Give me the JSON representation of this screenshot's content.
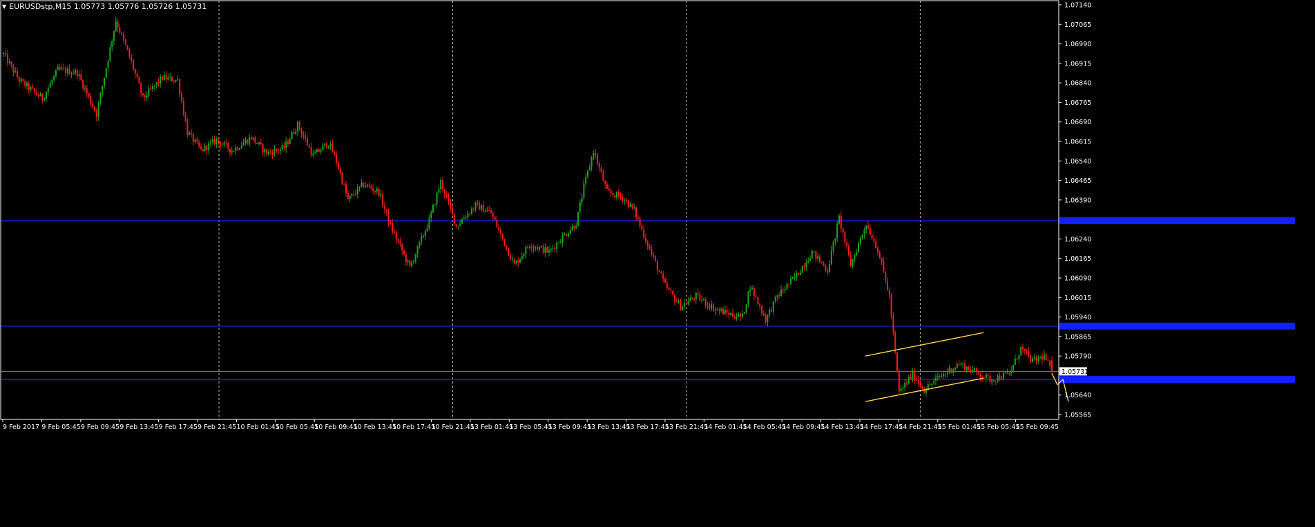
{
  "header": {
    "symbol_line": "EURUSDstp,M15  1.05773 1.05776 1.05726 1.05731"
  },
  "theme": {
    "background": "#000000",
    "frame": "#ffffff",
    "text": "#ffffff",
    "grid": "#c0c0c0",
    "bull": "#1aa81a",
    "bear": "#ff1a1a",
    "hline": "#1020ff",
    "channel": "#ffd24d",
    "price_line": "#808080"
  },
  "chart_data": {
    "type": "candlestick",
    "symbol": "EURUSDstp",
    "timeframe": "M15",
    "ohlc_last": {
      "open": 1.05773,
      "high": 1.05776,
      "low": 1.05726,
      "close": 1.05731
    },
    "ylim": [
      1.05565,
      1.0714
    ],
    "y_ticks": [
      "1.07140",
      "1.07065",
      "1.06990",
      "1.06915",
      "1.06840",
      "1.06765",
      "1.06690",
      "1.06615",
      "1.06540",
      "1.06465",
      "1.06390",
      "1.06240",
      "1.06165",
      "1.06090",
      "1.06015",
      "1.05940",
      "1.05865",
      "1.05790",
      "1.05640",
      "1.05565"
    ],
    "x_ticks": [
      "9 Feb 2017",
      "9 Feb 05:45",
      "9 Feb 09:45",
      "9 Feb 13:45",
      "9 Feb 17:45",
      "9 Feb 21:45",
      "10 Feb 01:45",
      "10 Feb 05:45",
      "10 Feb 09:45",
      "10 Feb 13:45",
      "10 Feb 17:45",
      "10 Feb 21:45",
      "13 Feb 01:45",
      "13 Feb 05:45",
      "13 Feb 09:45",
      "13 Feb 13:45",
      "13 Feb 17:45",
      "13 Feb 21:45",
      "14 Feb 01:45",
      "14 Feb 05:45",
      "14 Feb 09:45",
      "14 Feb 13:45",
      "14 Feb 17:45",
      "14 Feb 21:45",
      "15 Feb 01:45",
      "15 Feb 05:45",
      "15 Feb 09:45"
    ],
    "period_separators": [
      "9 Feb 21:45",
      "10 Feb 21:45",
      "13 Feb 21:45",
      "14 Feb 21:45"
    ],
    "horizontal_lines": [
      1.0631,
      1.05905,
      1.057
    ],
    "current_price": "1.05731",
    "trend_channel": {
      "upper": {
        "from": [
          "14 Feb 17:45",
          1.0579
        ],
        "to": [
          "15 Feb 05:45",
          1.0588
        ]
      },
      "lower": {
        "from": [
          "14 Feb 17:45",
          1.05615
        ],
        "to": [
          "15 Feb 05:45",
          1.05705
        ]
      }
    },
    "projection_path": [
      [
        0,
        1.05723
      ],
      [
        1,
        1.0568
      ],
      [
        2,
        1.057
      ],
      [
        3,
        1.05615
      ]
    ],
    "price_path": [
      [
        0,
        1.0695
      ],
      [
        8,
        1.0685
      ],
      [
        20,
        1.0678
      ],
      [
        28,
        1.0689
      ],
      [
        38,
        1.0688
      ],
      [
        48,
        1.0672
      ],
      [
        58,
        1.0708
      ],
      [
        66,
        1.0692
      ],
      [
        72,
        1.0678
      ],
      [
        82,
        1.0686
      ],
      [
        90,
        1.0685
      ],
      [
        95,
        1.0665
      ],
      [
        102,
        1.0658
      ],
      [
        110,
        1.0662
      ],
      [
        118,
        1.0658
      ],
      [
        128,
        1.0663
      ],
      [
        136,
        1.0657
      ],
      [
        145,
        1.0659
      ],
      [
        152,
        1.0668
      ],
      [
        160,
        1.0656
      ],
      [
        168,
        1.0661
      ],
      [
        172,
        1.0654
      ],
      [
        178,
        1.0639
      ],
      [
        186,
        1.0645
      ],
      [
        194,
        1.0642
      ],
      [
        200,
        1.0629
      ],
      [
        210,
        1.0613
      ],
      [
        220,
        1.0631
      ],
      [
        226,
        1.0646
      ],
      [
        234,
        1.0629
      ],
      [
        244,
        1.0637
      ],
      [
        252,
        1.0634
      ],
      [
        258,
        1.0624
      ],
      [
        264,
        1.0614
      ],
      [
        272,
        1.0622
      ],
      [
        282,
        1.0619
      ],
      [
        288,
        1.0624
      ],
      [
        296,
        1.063
      ],
      [
        300,
        1.0644
      ],
      [
        305,
        1.0658
      ],
      [
        312,
        1.0642
      ],
      [
        320,
        1.064
      ],
      [
        326,
        1.0635
      ],
      [
        334,
        1.062
      ],
      [
        342,
        1.0606
      ],
      [
        350,
        1.0598
      ],
      [
        358,
        1.0602
      ],
      [
        368,
        1.0597
      ],
      [
        376,
        1.0595
      ],
      [
        382,
        1.0594
      ],
      [
        386,
        1.0606
      ],
      [
        394,
        1.0593
      ],
      [
        400,
        1.0602
      ],
      [
        410,
        1.061
      ],
      [
        418,
        1.0619
      ],
      [
        426,
        1.0612
      ],
      [
        432,
        1.0632
      ],
      [
        438,
        1.0614
      ],
      [
        446,
        1.063
      ],
      [
        452,
        1.062
      ],
      [
        458,
        1.0602
      ],
      [
        463,
        1.0565
      ],
      [
        470,
        1.0572
      ],
      [
        476,
        1.0566
      ],
      [
        484,
        1.0571
      ],
      [
        494,
        1.0576
      ],
      [
        502,
        1.0573
      ],
      [
        510,
        1.057
      ],
      [
        520,
        1.0572
      ],
      [
        526,
        1.0582
      ],
      [
        532,
        1.0577
      ],
      [
        538,
        1.0579
      ],
      [
        542,
        1.05731
      ]
    ]
  }
}
